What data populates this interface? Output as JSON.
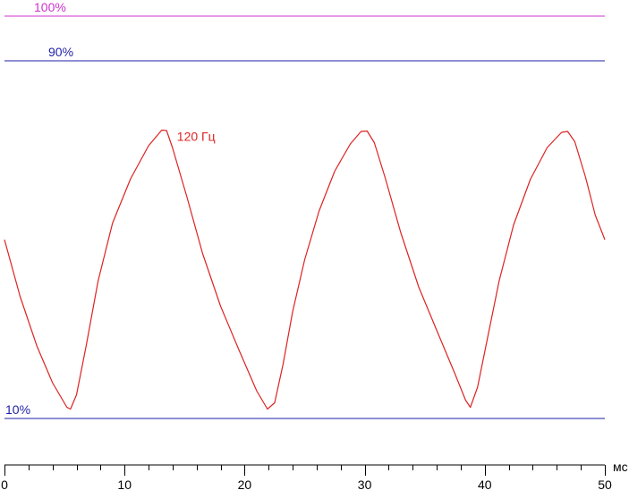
{
  "chart_data": {
    "type": "line",
    "title": "",
    "xlabel": "",
    "ylabel": "",
    "x_unit": "мс",
    "xlim": [
      0,
      50
    ],
    "ylim": [
      0,
      100
    ],
    "x_major_ticks": [
      0,
      10,
      20,
      30,
      40,
      50
    ],
    "x_minor_step": 2,
    "grid": false,
    "reference_lines": [
      {
        "label": "100%",
        "y": 100,
        "color": "#cc33cc"
      },
      {
        "label": "90%",
        "y": 90,
        "color": "#1f1fa8"
      },
      {
        "label": "10%",
        "y": 10,
        "color": "#1f1fa8"
      }
    ],
    "series": [
      {
        "name": "120 Гц",
        "color": "#dd2222",
        "x": [
          0,
          1.3,
          2.7,
          4.0,
          5.2,
          5.5,
          6.0,
          6.8,
          7.8,
          9.0,
          10.5,
          12.0,
          13.1,
          13.5,
          14.0,
          15.2,
          16.5,
          18.0,
          19.5,
          21.0,
          21.9,
          22.5,
          23.2,
          24.0,
          25.0,
          26.2,
          27.5,
          28.8,
          29.7,
          30.2,
          30.8,
          31.7,
          33.0,
          34.5,
          36.0,
          37.5,
          38.4,
          38.8,
          39.4,
          40.2,
          41.2,
          42.4,
          43.8,
          45.2,
          46.4,
          46.9,
          47.5,
          48.4,
          49.2,
          50.0
        ],
        "y": [
          50.0,
          37.3,
          26.2,
          18.0,
          12.5,
          12.1,
          15.3,
          26.2,
          40.8,
          53.7,
          63.6,
          71.0,
          74.5,
          74.4,
          70.5,
          59.5,
          46.9,
          35.1,
          25.5,
          16.2,
          12.1,
          13.5,
          22.1,
          33.9,
          45.5,
          56.4,
          65.3,
          71.4,
          74.2,
          74.3,
          71.7,
          63.9,
          51.6,
          39.4,
          29.7,
          20.1,
          14.1,
          12.5,
          17.0,
          27.6,
          40.8,
          53.3,
          63.5,
          70.6,
          74.0,
          74.2,
          71.9,
          63.9,
          55.5,
          50.0
        ]
      }
    ]
  }
}
